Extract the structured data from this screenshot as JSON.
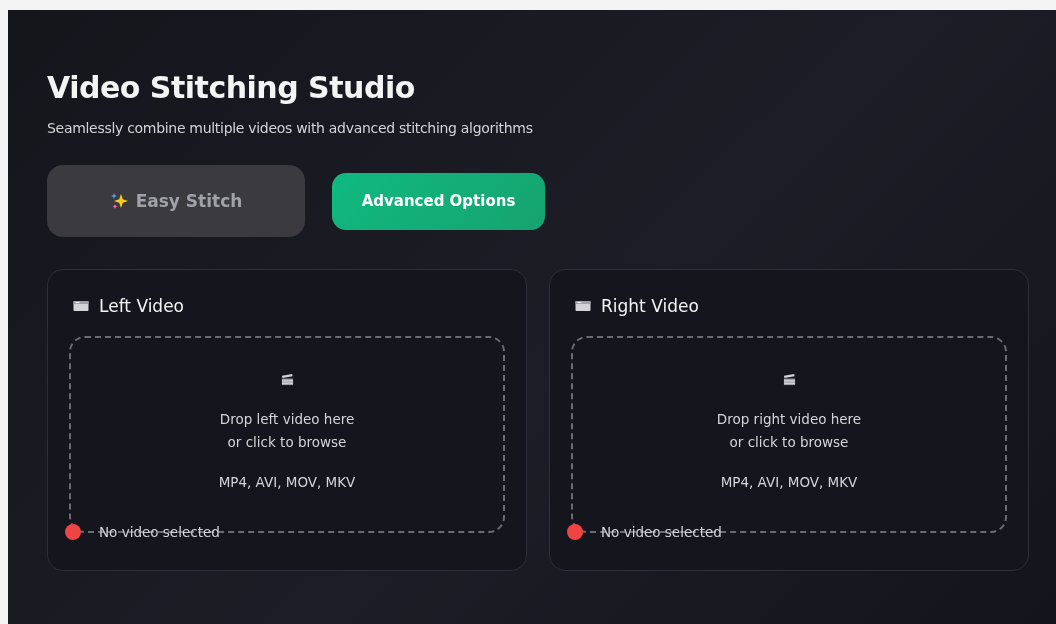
{
  "header": {
    "title": "Video Stitching Studio",
    "subtitle": "Seamlessly combine multiple videos with advanced stitching algorithms"
  },
  "tabs": [
    {
      "label": "Easy Stitch",
      "kind": "sparkle",
      "selected": false
    },
    {
      "label": "Advanced Options",
      "kind": "plain",
      "selected": true
    }
  ],
  "panels": [
    {
      "title": "Left Video",
      "drop_text": "Drop left video here",
      "browse_text": "or click to browse",
      "formats": "MP4, AVI, MOV, MKV",
      "status": "No video selected",
      "video_loaded": false
    },
    {
      "title": "Right Video",
      "drop_text": "Drop right video here",
      "browse_text": "or click to browse",
      "formats": "MP4, AVI, MOV, MKV",
      "status": "No video selected",
      "video_loaded": false
    }
  ]
}
